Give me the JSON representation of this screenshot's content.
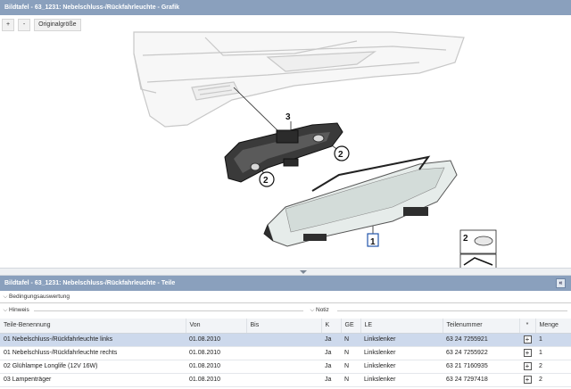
{
  "graphic_panel": {
    "title": "Bildtafel - 63_1231: Nebelschluss-/Rückfahrleuchte - Grafik",
    "toolbar": {
      "zoom_in": "+",
      "zoom_out": "-",
      "original_size": "Originalgröße"
    },
    "callouts": {
      "housing": "3",
      "bulb_a": "2",
      "bulb_b": "2",
      "lamp": "1",
      "legend_bulb": "2"
    }
  },
  "parts_panel": {
    "title": "Bildtafel - 63_1231: Nebelschluss-/Rückfahrleuchte - Teile",
    "collapse": "«",
    "sections": {
      "conditions": "Bedingungsauswertung",
      "hints": "Hinweis",
      "notes": "Notiz"
    },
    "columns": {
      "name": "Teile-Benennung",
      "from": "Von",
      "to": "Bis",
      "k": "K",
      "ge": "GE",
      "le": "LE",
      "part_no": "Teilenummer",
      "star": "*",
      "qty": "Menge"
    },
    "rows": [
      {
        "name": "01 Nebelschluss-/Rückfahrleuchte links",
        "from": "01.08.2010",
        "to": "",
        "k": "Ja",
        "ge": "N",
        "le": "Linkslenker",
        "part_no": "63 24 7255921",
        "add": "+",
        "qty": "1"
      },
      {
        "name": "01 Nebelschluss-/Rückfahrleuchte rechts",
        "from": "01.08.2010",
        "to": "",
        "k": "Ja",
        "ge": "N",
        "le": "Linkslenker",
        "part_no": "63 24 7255922",
        "add": "+",
        "qty": "1"
      },
      {
        "name": "02 Glühlampe Longlife (12V 16W)",
        "from": "01.08.2010",
        "to": "",
        "k": "Ja",
        "ge": "N",
        "le": "Linkslenker",
        "part_no": "63 21 7160935",
        "add": "+",
        "qty": "2"
      },
      {
        "name": "03 Lampenträger",
        "from": "01.08.2010",
        "to": "",
        "k": "Ja",
        "ge": "N",
        "le": "Linkslenker",
        "part_no": "63 24 7297418",
        "add": "+",
        "qty": "2"
      }
    ]
  }
}
